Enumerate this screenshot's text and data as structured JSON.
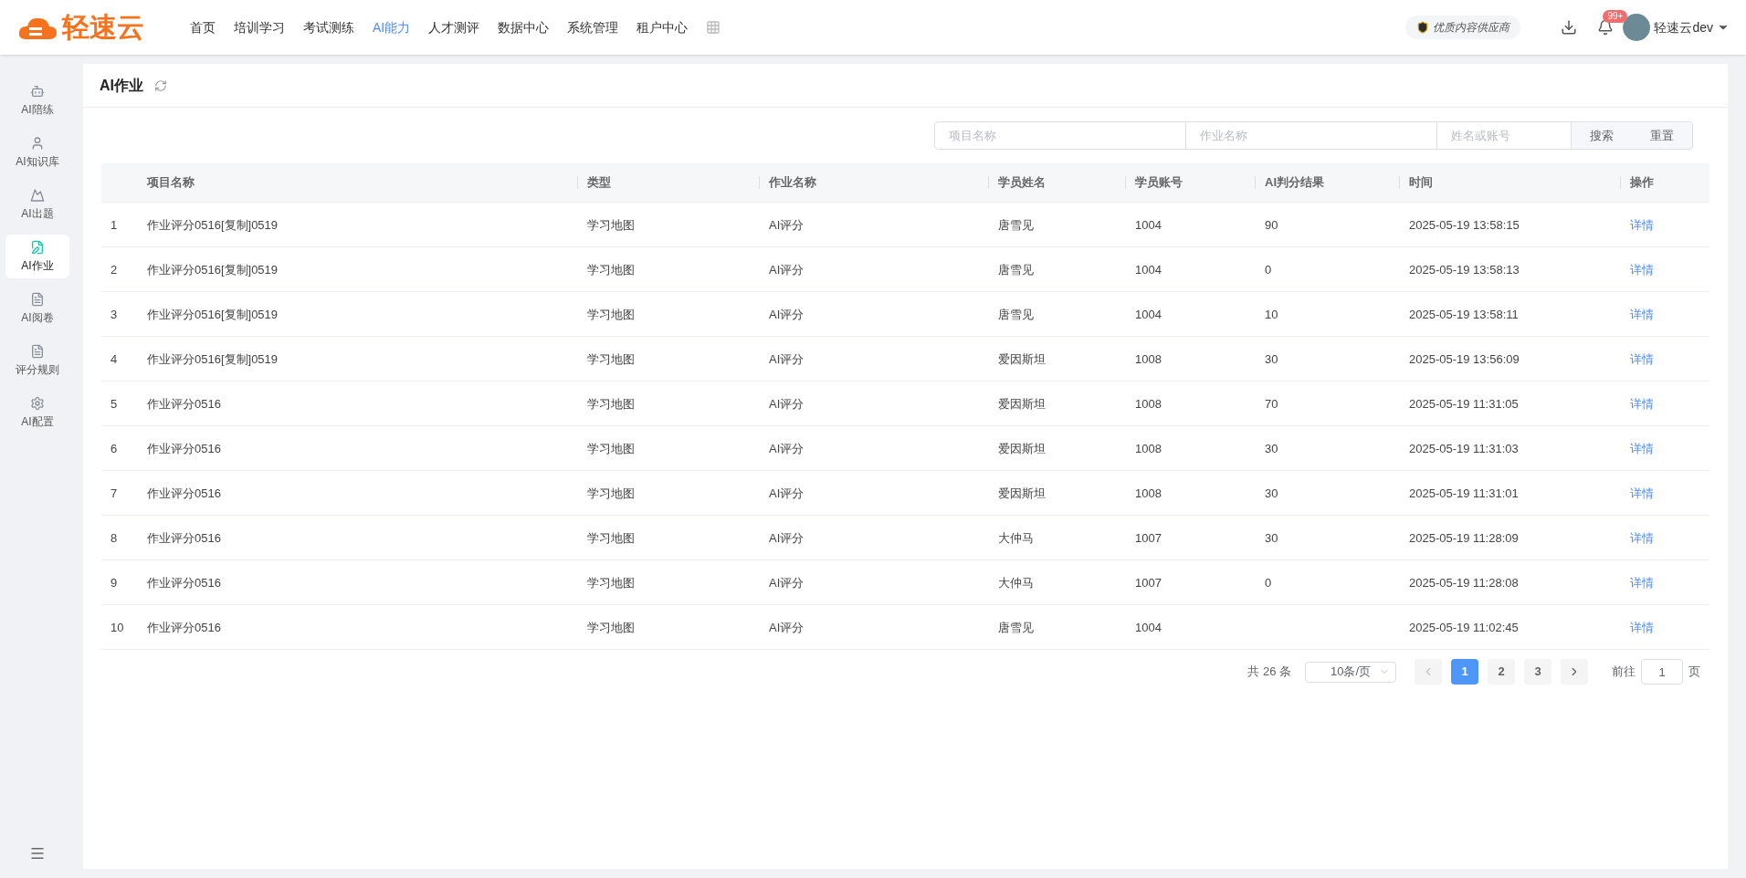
{
  "header": {
    "logo": "轻速云",
    "nav": [
      {
        "label": "首页",
        "selected": false
      },
      {
        "label": "培训学习",
        "selected": false
      },
      {
        "label": "考试测练",
        "selected": false
      },
      {
        "label": "AI能力",
        "selected": true
      },
      {
        "label": "人才测评",
        "selected": false
      },
      {
        "label": "数据中心",
        "selected": false
      },
      {
        "label": "系统管理",
        "selected": false
      },
      {
        "label": "租户中心",
        "selected": false
      }
    ],
    "badge": "优质内容供应商",
    "notifications": "99+",
    "user": "轻速云dev"
  },
  "sidebar": {
    "items": [
      {
        "label": "AI陪练",
        "kind": "robot",
        "selected": false
      },
      {
        "label": "AI知识库",
        "kind": "person",
        "selected": false
      },
      {
        "label": "AI出题",
        "kind": "mountain",
        "selected": false
      },
      {
        "label": "AI作业",
        "kind": "docpen",
        "selected": true
      },
      {
        "label": "AI阅卷",
        "kind": "paper",
        "selected": false
      },
      {
        "label": "评分规则",
        "kind": "paper",
        "selected": false
      },
      {
        "label": "AI配置",
        "kind": "gear",
        "selected": false
      }
    ]
  },
  "page": {
    "title": "AI作业"
  },
  "search": {
    "fields": [
      {
        "placeholder": "项目名称"
      },
      {
        "placeholder": "作业名称"
      },
      {
        "placeholder": "姓名或账号"
      }
    ],
    "buttons": [
      "搜索",
      "重置"
    ]
  },
  "table": {
    "columns": [
      "",
      "项目名称",
      "类型",
      "作业名称",
      "学员姓名",
      "学员账号",
      "AI判分结果",
      "时间",
      "操作"
    ],
    "rows": [
      [
        "1",
        "作业评分0516[复制]0519",
        "学习地图",
        "AI评分",
        "唐雪见",
        "1004",
        "90",
        "2025-05-19 13:58:15",
        "详情"
      ],
      [
        "2",
        "作业评分0516[复制]0519",
        "学习地图",
        "AI评分",
        "唐雪见",
        "1004",
        "0",
        "2025-05-19 13:58:13",
        "详情"
      ],
      [
        "3",
        "作业评分0516[复制]0519",
        "学习地图",
        "AI评分",
        "唐雪见",
        "1004",
        "10",
        "2025-05-19 13:58:11",
        "详情"
      ],
      [
        "4",
        "作业评分0516[复制]0519",
        "学习地图",
        "AI评分",
        "爱因斯坦",
        "1008",
        "30",
        "2025-05-19 13:56:09",
        "详情"
      ],
      [
        "5",
        "作业评分0516",
        "学习地图",
        "AI评分",
        "爱因斯坦",
        "1008",
        "70",
        "2025-05-19 11:31:05",
        "详情"
      ],
      [
        "6",
        "作业评分0516",
        "学习地图",
        "AI评分",
        "爱因斯坦",
        "1008",
        "30",
        "2025-05-19 11:31:03",
        "详情"
      ],
      [
        "7",
        "作业评分0516",
        "学习地图",
        "AI评分",
        "爱因斯坦",
        "1008",
        "30",
        "2025-05-19 11:31:01",
        "详情"
      ],
      [
        "8",
        "作业评分0516",
        "学习地图",
        "AI评分",
        "大仲马",
        "1007",
        "30",
        "2025-05-19 11:28:09",
        "详情"
      ],
      [
        "9",
        "作业评分0516",
        "学习地图",
        "AI评分",
        "大仲马",
        "1007",
        "0",
        "2025-05-19 11:28:08",
        "详情"
      ],
      [
        "10",
        "作业评分0516",
        "学习地图",
        "AI评分",
        "唐雪见",
        "1004",
        "",
        "2025-05-19 11:02:45",
        "详情"
      ]
    ]
  },
  "pagination": {
    "total": "共 26 条",
    "page_size": "10条/页",
    "pages": [
      {
        "label": "1",
        "selected": true
      },
      {
        "label": "2",
        "selected": false
      },
      {
        "label": "3",
        "selected": false
      }
    ],
    "goto_label": "前往",
    "goto_value": "1",
    "goto_suffix": "页"
  }
}
